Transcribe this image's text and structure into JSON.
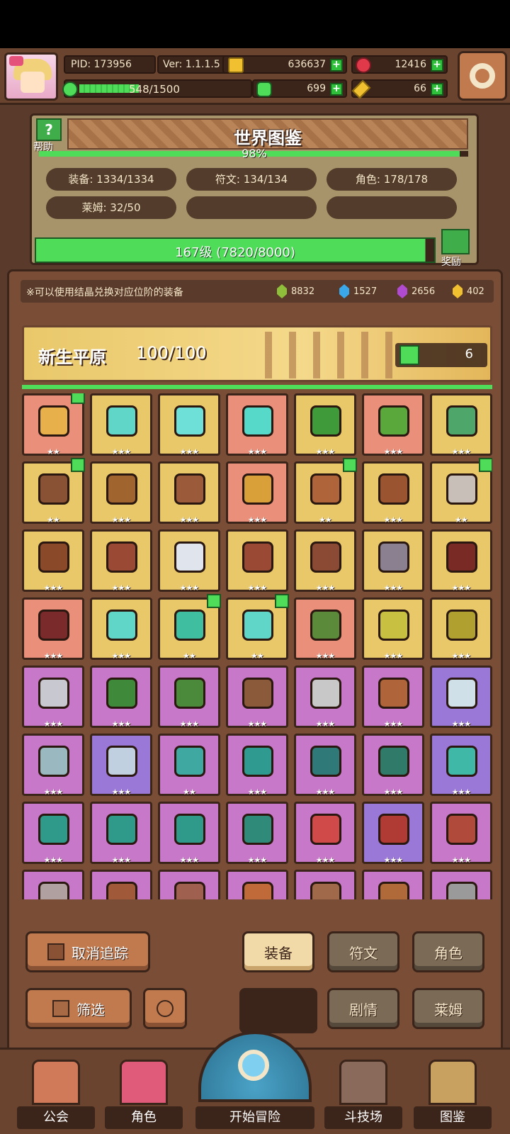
{
  "header": {
    "pid": "PID: 173956",
    "version": "Ver: 1.1.1.5",
    "gold": "636637",
    "ruby": "12416",
    "exp": "548/1500",
    "exp_fraction": 0.365,
    "clover": "699",
    "keys": "66"
  },
  "book": {
    "title": "世界图鉴",
    "help_label": "帮助",
    "percent": "98%",
    "percent_value": 0.98,
    "stats": [
      "装备: 1334/1334",
      "符文: 134/134",
      "角色: 178/178",
      "莱姆: 32/50"
    ],
    "level": "167级 (7820/8000)",
    "level_fraction": 0.9775,
    "reward_label": "奖励"
  },
  "collection": {
    "note": "※可以使用结晶兑换对应位阶的装备",
    "crystals": [
      {
        "value": "8832",
        "color": "#8fbf3a"
      },
      {
        "value": "1527",
        "color": "#3aa8e8"
      },
      {
        "value": "2656",
        "color": "#b04ad0"
      },
      {
        "value": "402",
        "color": "#f0c030"
      }
    ],
    "zone_name": "新生平原",
    "zone_count": "100/100",
    "tracked_count": "6"
  },
  "items": [
    {
      "bg": "#e98f7a",
      "color": "#e8b04a",
      "stars": "★★",
      "tracked": true,
      "name": "straw-hat"
    },
    {
      "bg": "#e9c86a",
      "color": "#5fd6c8",
      "stars": "★★★",
      "tracked": false,
      "name": "aqua-staff"
    },
    {
      "bg": "#e9c86a",
      "color": "#6fe0d8",
      "stars": "★★★",
      "tracked": false,
      "name": "aqua-orb"
    },
    {
      "bg": "#e98f7a",
      "color": "#56d9c9",
      "stars": "★★★",
      "tracked": false,
      "name": "aqua-gem"
    },
    {
      "bg": "#e9c86a",
      "color": "#3f9a3a",
      "stars": "★★★",
      "tracked": false,
      "name": "green-hood"
    },
    {
      "bg": "#e98f7a",
      "color": "#5aa83c",
      "stars": "★★★",
      "tracked": false,
      "name": "green-armor"
    },
    {
      "bg": "#e9c86a",
      "color": "#4fa66a",
      "stars": "★★★",
      "tracked": false,
      "name": "green-ring"
    },
    {
      "bg": "#e9c86a",
      "color": "#8a5234",
      "stars": "★★",
      "tracked": true,
      "name": "crossbow"
    },
    {
      "bg": "#e9c86a",
      "color": "#a0642e",
      "stars": "★★★",
      "tracked": false,
      "name": "spear"
    },
    {
      "bg": "#e9c86a",
      "color": "#9b5a3a",
      "stars": "★★★",
      "tracked": false,
      "name": "amulet"
    },
    {
      "bg": "#e98f7a",
      "color": "#d9a03a",
      "stars": "★★★",
      "tracked": false,
      "name": "horn"
    },
    {
      "bg": "#e9c86a",
      "color": "#b0643a",
      "stars": "★★",
      "tracked": true,
      "name": "bracelet"
    },
    {
      "bg": "#e9c86a",
      "color": "#9a5430",
      "stars": "★★★",
      "tracked": false,
      "name": "gem-ring"
    },
    {
      "bg": "#e9c86a",
      "color": "#c8c0b8",
      "stars": "★★",
      "tracked": true,
      "name": "axe"
    },
    {
      "bg": "#e9c86a",
      "color": "#8a4a2a",
      "stars": "★★★",
      "tracked": false,
      "name": "crown-ring"
    },
    {
      "bg": "#e9c86a",
      "color": "#9a4a34",
      "stars": "★★★",
      "tracked": false,
      "name": "pot"
    },
    {
      "bg": "#e9c86a",
      "color": "#e0e4ec",
      "stars": "★★★",
      "tracked": false,
      "name": "pearl"
    },
    {
      "bg": "#e9c86a",
      "color": "#9a4a34",
      "stars": "★★★",
      "tracked": false,
      "name": "gauntlet"
    },
    {
      "bg": "#e9c86a",
      "color": "#8a4a34",
      "stars": "★★★",
      "tracked": false,
      "name": "necklace"
    },
    {
      "bg": "#e9c86a",
      "color": "#8a8090",
      "stars": "★★★",
      "tracked": false,
      "name": "sword"
    },
    {
      "bg": "#e9c86a",
      "color": "#7a2a24",
      "stars": "★★★",
      "tracked": false,
      "name": "red-hood"
    },
    {
      "bg": "#e98f7a",
      "color": "#7a2a2a",
      "stars": "★★★",
      "tracked": false,
      "name": "dark-armor"
    },
    {
      "bg": "#e9c86a",
      "color": "#5fd6c8",
      "stars": "★★★",
      "tracked": false,
      "name": "aqua-bow"
    },
    {
      "bg": "#e9c86a",
      "color": "#3fbfa0",
      "stars": "★★",
      "tracked": true,
      "name": "aqua-arrow"
    },
    {
      "bg": "#e9c86a",
      "color": "#5fd6c8",
      "stars": "★★",
      "tracked": true,
      "name": "aqua-boots"
    },
    {
      "bg": "#e98f7a",
      "color": "#5a8a3a",
      "stars": "★★★",
      "tracked": false,
      "name": "leaf-hood"
    },
    {
      "bg": "#e9c86a",
      "color": "#c8c040",
      "stars": "★★★",
      "tracked": false,
      "name": "gold-glove"
    },
    {
      "bg": "#e9c86a",
      "color": "#b0a030",
      "stars": "★★★",
      "tracked": false,
      "name": "gold-armor"
    },
    {
      "bg": "#c878c8",
      "color": "#c8c8d0",
      "stars": "★★★",
      "tracked": false,
      "name": "long-sword"
    },
    {
      "bg": "#c878c8",
      "color": "#3f8a3a",
      "stars": "★★★",
      "tracked": false,
      "name": "forest-hood"
    },
    {
      "bg": "#c878c8",
      "color": "#4a8a3a",
      "stars": "★★★",
      "tracked": false,
      "name": "forest-armor"
    },
    {
      "bg": "#c878c8",
      "color": "#8a5a3a",
      "stars": "★★★",
      "tracked": false,
      "name": "bow"
    },
    {
      "bg": "#c878c8",
      "color": "#c8c8c8",
      "stars": "★★★",
      "tracked": false,
      "name": "arrow"
    },
    {
      "bg": "#c878c8",
      "color": "#b0643a",
      "stars": "★★★",
      "tracked": false,
      "name": "leather-boots"
    },
    {
      "bg": "#9a78d8",
      "color": "#d0e0e8",
      "stars": "★★★",
      "tracked": false,
      "name": "silver-armor"
    },
    {
      "bg": "#c878c8",
      "color": "#9ab8c0",
      "stars": "★★★",
      "tracked": false,
      "name": "silver-ring"
    },
    {
      "bg": "#9a78d8",
      "color": "#c0d0e0",
      "stars": "★★★",
      "tracked": false,
      "name": "silver-boots"
    },
    {
      "bg": "#c878c8",
      "color": "#3fa8a0",
      "stars": "★★",
      "tracked": false,
      "name": "jade-staff"
    },
    {
      "bg": "#c878c8",
      "color": "#2f9a90",
      "stars": "★★★",
      "tracked": false,
      "name": "jade-hat"
    },
    {
      "bg": "#c878c8",
      "color": "#2f7a78",
      "stars": "★★★",
      "tracked": false,
      "name": "jade-armor"
    },
    {
      "bg": "#c878c8",
      "color": "#2f7a68",
      "stars": "★★★",
      "tracked": false,
      "name": "jade-glove"
    },
    {
      "bg": "#9a78d8",
      "color": "#3fb8a8",
      "stars": "★★★",
      "tracked": false,
      "name": "jade-gem"
    },
    {
      "bg": "#c878c8",
      "color": "#2f9a8a",
      "stars": "★★★",
      "tracked": false,
      "name": "jade-boots"
    },
    {
      "bg": "#c878c8",
      "color": "#2f9a8a",
      "stars": "★★★",
      "tracked": false,
      "name": "jade-star"
    },
    {
      "bg": "#c878c8",
      "color": "#2f9a8a",
      "stars": "★★★",
      "tracked": false,
      "name": "jade-necklace"
    },
    {
      "bg": "#c878c8",
      "color": "#2f8a7a",
      "stars": "★★★",
      "tracked": false,
      "name": "jade-ring"
    },
    {
      "bg": "#c878c8",
      "color": "#d04a4a",
      "stars": "★★★",
      "tracked": false,
      "name": "red-mask"
    },
    {
      "bg": "#9a78d8",
      "color": "#b03a34",
      "stars": "★★★",
      "tracked": false,
      "name": "red-armor"
    },
    {
      "bg": "#c878c8",
      "color": "#b04a3a",
      "stars": "★★★",
      "tracked": false,
      "name": "red-boots"
    },
    {
      "bg": "#c878c8",
      "color": "#b0a0a0",
      "stars": "",
      "tracked": false,
      "name": "helm-a"
    },
    {
      "bg": "#c878c8",
      "color": "#a05a3a",
      "stars": "",
      "tracked": false,
      "name": "chest-b"
    },
    {
      "bg": "#c878c8",
      "color": "#a06050",
      "stars": "",
      "tracked": false,
      "name": "necklace-c"
    },
    {
      "bg": "#c878c8",
      "color": "#c06a3a",
      "stars": "",
      "tracked": false,
      "name": "staff-d"
    },
    {
      "bg": "#c878c8",
      "color": "#a06a4a",
      "stars": "",
      "tracked": false,
      "name": "horned-helm"
    },
    {
      "bg": "#c878c8",
      "color": "#b06a3a",
      "stars": "",
      "tracked": false,
      "name": "armor-f"
    },
    {
      "bg": "#c878c8",
      "color": "#9a9a9a",
      "stars": "",
      "tracked": false,
      "name": "trident-g"
    }
  ],
  "buttons": {
    "untrack": "取消追踪",
    "filter": "筛选",
    "equip": "装备",
    "rune": "符文",
    "role": "角色",
    "story": "剧情",
    "slime": "莱姆"
  },
  "nav": {
    "guild": "公会",
    "role": "角色",
    "adventure": "开始冒险",
    "arena": "斗技场",
    "book": "图鉴"
  }
}
